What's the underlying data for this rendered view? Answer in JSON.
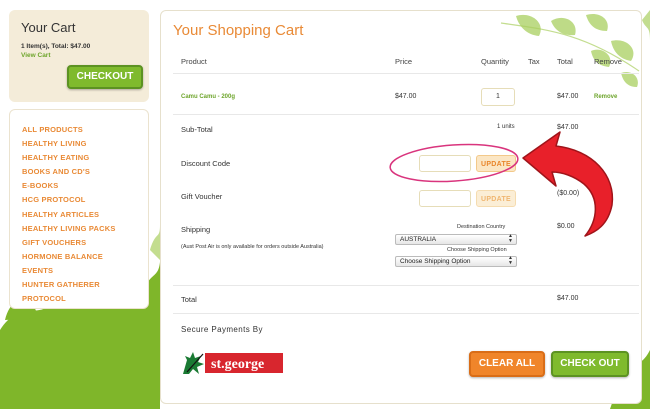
{
  "cart": {
    "title": "Your Cart",
    "summary": "1 Item(s), Total: $47.00",
    "view_cart": "View Cart",
    "checkout": "CHECKOUT"
  },
  "menu": {
    "items": [
      "ALL PRODUCTS",
      "HEALTHY LIVING",
      "HEALTHY EATING",
      "BOOKS AND CD'S",
      "E-BOOKS",
      "HCG PROTOCOL",
      "HEALTHY ARTICLES",
      "HEALTHY LIVING PACKS",
      "GIFT VOUCHERS",
      "HORMONE BALANCE",
      "EVENTS",
      "HUNTER GATHERER",
      "PROTOCOL"
    ]
  },
  "main": {
    "title": "Your Shopping Cart",
    "headers": {
      "product": "Product",
      "price": "Price",
      "quantity": "Quantity",
      "tax": "Tax",
      "total": "Total",
      "remove": "Remove"
    },
    "row": {
      "product": "Camu Camu - 200g",
      "price": "$47.00",
      "quantity": "1",
      "total": "$47.00",
      "remove": "Remove"
    },
    "subtotal": {
      "label": "Sub-Total",
      "units": "1 units",
      "value": "$47.00"
    },
    "discount": {
      "label": "Discount Code",
      "button": "UPDATE"
    },
    "voucher": {
      "label": "Gift Voucher",
      "button": "UPDATE",
      "value": "($0.00)"
    },
    "shipping": {
      "label": "Shipping",
      "note": "(Aust Post Air is only available for orders outside Australia)",
      "destination_label": "Destination Country",
      "country": "AUSTRALIA",
      "option_label": "Choose Shipping Option",
      "option_value": "Choose Shipping Option",
      "value": "$0.00"
    },
    "total": {
      "label": "Total",
      "value": "$47.00"
    },
    "secure_title": "Secure Payments By",
    "logo_text": "st.george",
    "clear_all": "CLEAR ALL",
    "check_out": "CHECK OUT"
  },
  "colors": {
    "accent_orange": "#e98a36",
    "accent_green": "#7fba2d",
    "annotation_red": "#e8202a",
    "highlight_pink": "#d9347d"
  }
}
